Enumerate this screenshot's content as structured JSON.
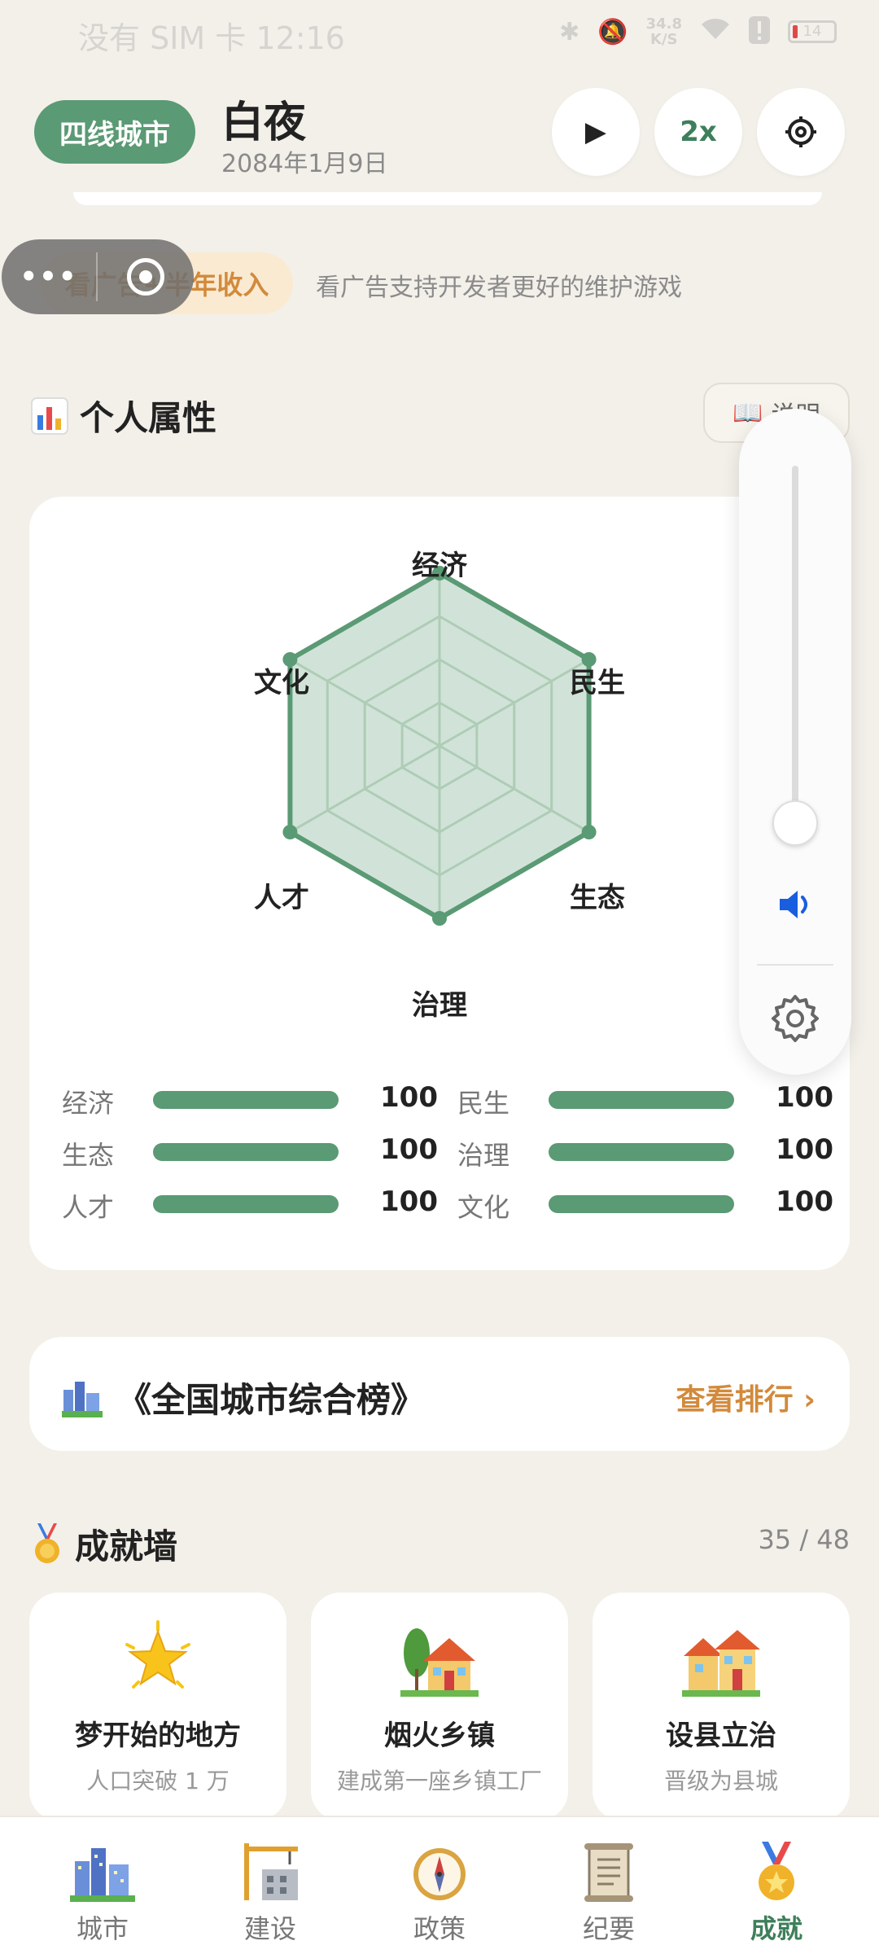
{
  "status_bar": {
    "left": "没有 SIM 卡 12:16",
    "speed_top": "34.8",
    "speed_bottom": "K/S",
    "battery": "14"
  },
  "header": {
    "city_badge": "四线城市",
    "name": "白夜",
    "date": "2084年1月9日",
    "play_glyph": "▶",
    "speed_label": "2x"
  },
  "ad": {
    "pill_label": "看广告+半年收入",
    "description": "看广告支持开发者更好的维护游戏"
  },
  "attributes": {
    "title": "个人属性",
    "explain_label": "说明",
    "radar_labels": [
      "经济",
      "民生",
      "生态",
      "治理",
      "人才",
      "文化"
    ],
    "radar_values": [
      100,
      100,
      100,
      100,
      100,
      100
    ],
    "radar_max": 100,
    "stats": [
      {
        "label": "经济",
        "value": "100"
      },
      {
        "label": "民生",
        "value": "100"
      },
      {
        "label": "生态",
        "value": "100"
      },
      {
        "label": "治理",
        "value": "100"
      },
      {
        "label": "人才",
        "value": "100"
      },
      {
        "label": "文化",
        "value": "100"
      }
    ]
  },
  "ranking": {
    "title": "《全国城市综合榜》",
    "link": "查看排行 ›"
  },
  "achievements": {
    "title": "成就墙",
    "count": "35 / 48",
    "cards": [
      {
        "name": "梦开始的地方",
        "desc": "人口突破 1 万",
        "icon": "star-icon"
      },
      {
        "name": "烟火乡镇",
        "desc": "建成第一座乡镇工厂",
        "icon": "cottage-icon"
      },
      {
        "name": "设县立治",
        "desc": "晋级为县城",
        "icon": "houses-icon"
      }
    ]
  },
  "nav": {
    "items": [
      {
        "label": "城市",
        "icon": "cityscape-icon",
        "active": false
      },
      {
        "label": "建设",
        "icon": "construction-icon",
        "active": false
      },
      {
        "label": "政策",
        "icon": "compass-icon",
        "active": false
      },
      {
        "label": "纪要",
        "icon": "scroll-icon",
        "active": false
      },
      {
        "label": "成就",
        "icon": "medal-icon",
        "active": true
      }
    ]
  },
  "volume": {
    "level": 0.02
  },
  "colors": {
    "accent": "#5a9a74",
    "accent_dark": "#3e7f5b",
    "orange": "#d28a3c",
    "background": "#f3f0ea",
    "volume_blue": "#1a5ee0"
  }
}
